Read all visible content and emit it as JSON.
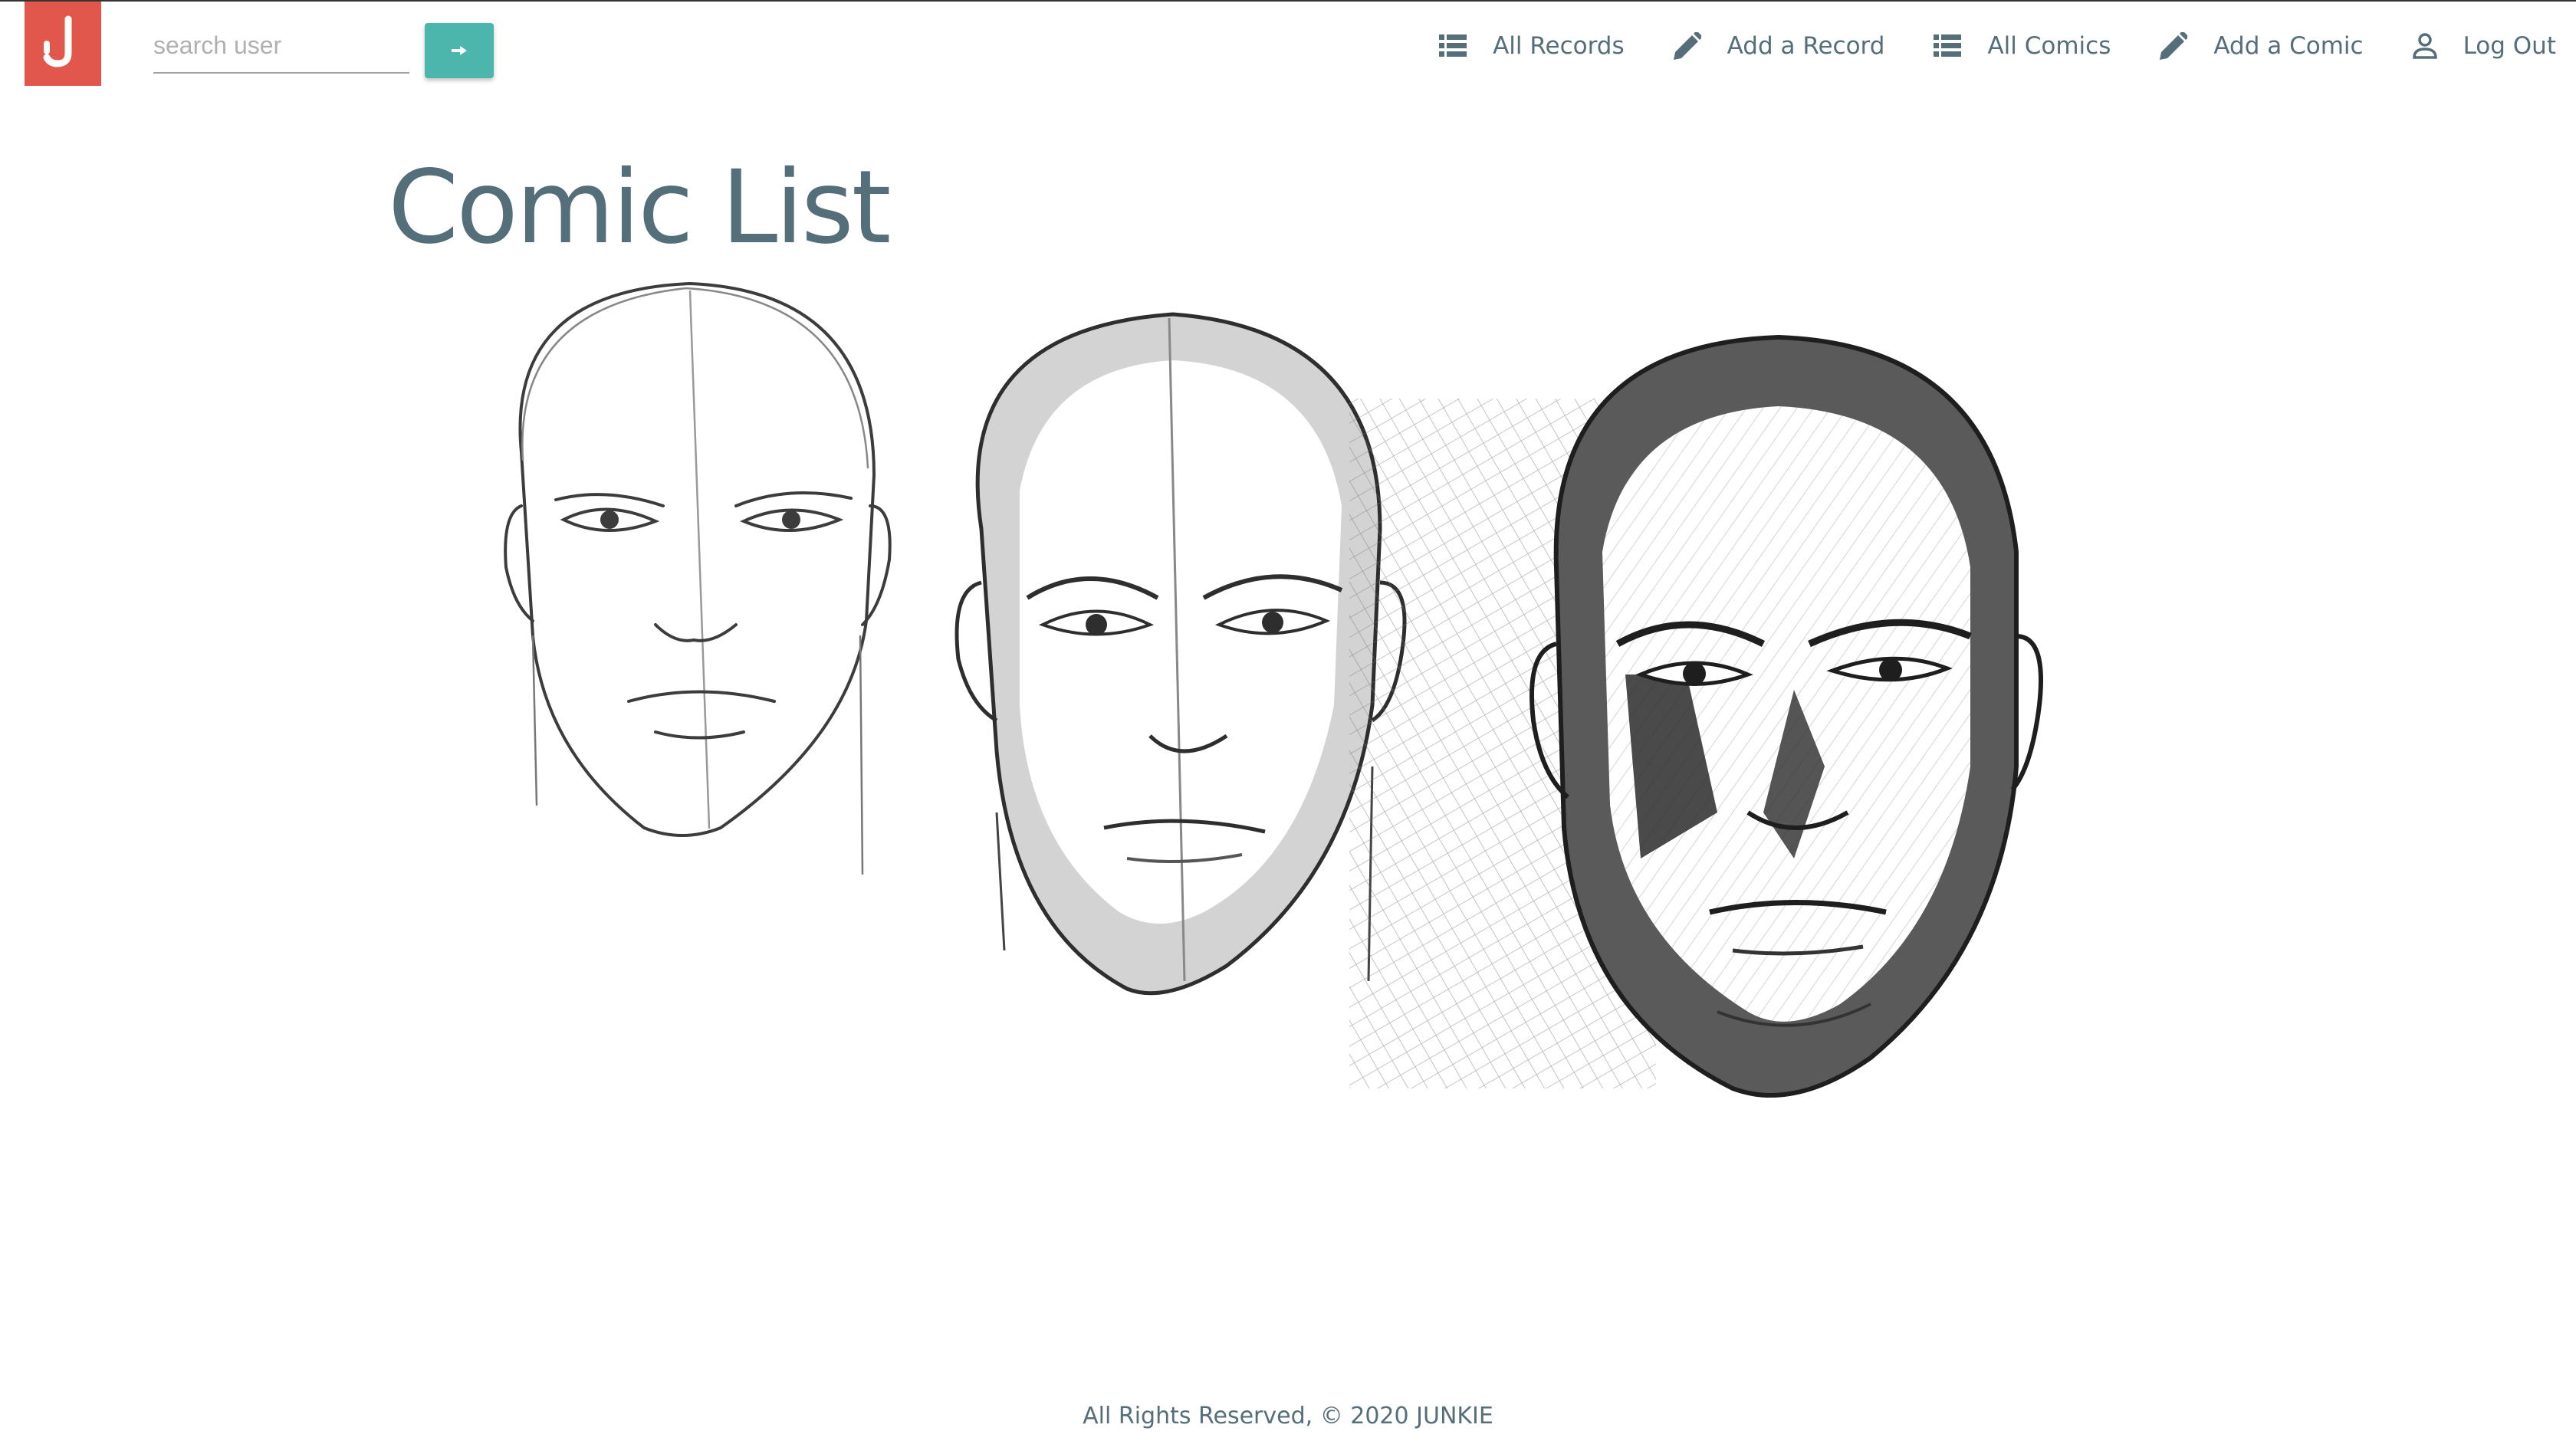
{
  "header": {
    "logo_letter": "J",
    "brand_color": "#e2574c",
    "accent_color": "#4db6ac",
    "search": {
      "placeholder": "search user",
      "value": ""
    },
    "search_button_icon": "arrow-right-icon"
  },
  "nav": {
    "items": [
      {
        "label": "All Records",
        "icon": "list-icon"
      },
      {
        "label": "Add a Record",
        "icon": "pencil-icon"
      },
      {
        "label": "All Comics",
        "icon": "list-icon"
      },
      {
        "label": "Add a Comic",
        "icon": "pencil-icon"
      },
      {
        "label": "Log Out",
        "icon": "user-icon"
      }
    ]
  },
  "main": {
    "title": "Comic List",
    "hero_image": "three-stage-comic-face-sketches"
  },
  "footer": {
    "text": "All Rights Reserved, © 2020 JUNKIE"
  }
}
